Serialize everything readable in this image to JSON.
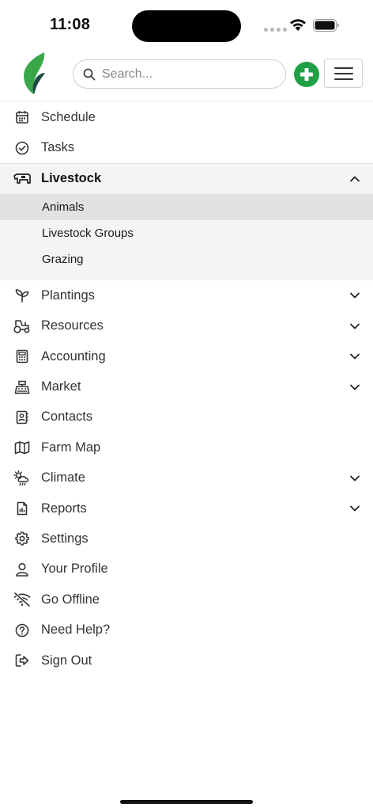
{
  "status_bar": {
    "time": "11:08"
  },
  "header": {
    "search_placeholder": "Search...",
    "icons": {
      "logo": "leaf-logo",
      "search": "search-icon",
      "add": "plus-circle-icon",
      "menu": "hamburger-icon"
    }
  },
  "colors": {
    "accent_green": "#21a046",
    "logo_green": "#3aa64a",
    "logo_dark": "#1c4a44",
    "active_bg": "#e2e2e2",
    "group_bg": "#f4f4f4"
  },
  "nav": {
    "schedule": {
      "label": "Schedule",
      "icon": "calendar-icon"
    },
    "tasks": {
      "label": "Tasks",
      "icon": "check-circle-icon"
    },
    "livestock": {
      "label": "Livestock",
      "icon": "cow-icon",
      "expanded": true,
      "children": [
        {
          "label": "Animals",
          "active": true
        },
        {
          "label": "Livestock Groups",
          "active": false
        },
        {
          "label": "Grazing",
          "active": false
        }
      ]
    },
    "plantings": {
      "label": "Plantings",
      "icon": "seedling-icon"
    },
    "resources": {
      "label": "Resources",
      "icon": "tractor-icon"
    },
    "accounting": {
      "label": "Accounting",
      "icon": "calculator-icon"
    },
    "market": {
      "label": "Market",
      "icon": "cash-register-icon"
    },
    "contacts": {
      "label": "Contacts",
      "icon": "address-book-icon"
    },
    "farm_map": {
      "label": "Farm Map",
      "icon": "map-icon"
    },
    "climate": {
      "label": "Climate",
      "icon": "sun-cloud-rain-icon"
    },
    "reports": {
      "label": "Reports",
      "icon": "report-chart-icon"
    },
    "settings": {
      "label": "Settings",
      "icon": "gear-icon"
    },
    "profile": {
      "label": "Your Profile",
      "icon": "user-icon"
    },
    "offline": {
      "label": "Go Offline",
      "icon": "wifi-off-icon"
    },
    "help": {
      "label": "Need Help?",
      "icon": "question-circle-icon"
    },
    "sign_out": {
      "label": "Sign Out",
      "icon": "sign-out-icon"
    }
  }
}
